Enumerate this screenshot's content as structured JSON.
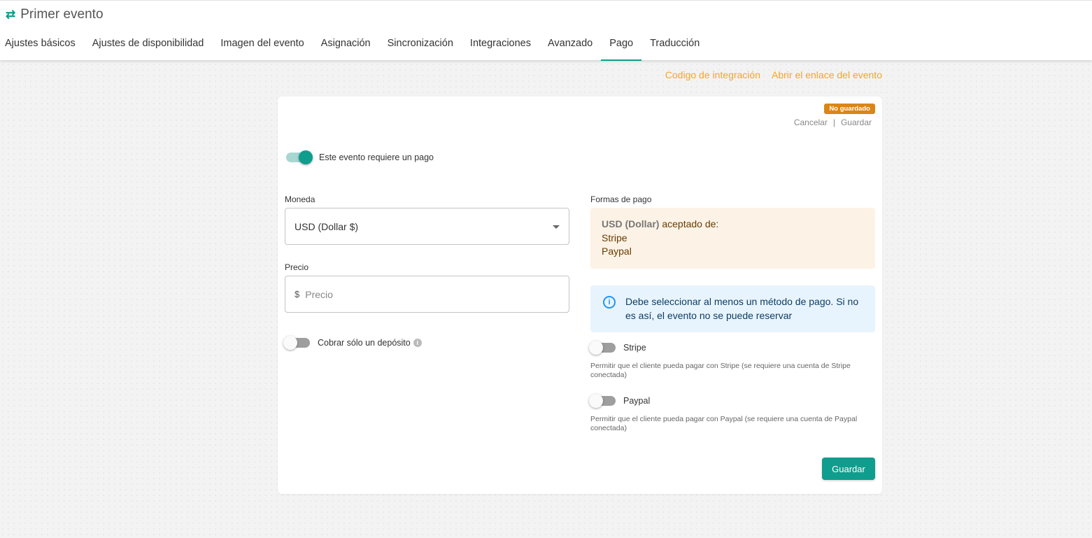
{
  "header": {
    "title_icon": "⇄",
    "title": "Primer evento",
    "tabs": [
      {
        "label": "Ajustes básicos"
      },
      {
        "label": "Ajustes de disponibilidad"
      },
      {
        "label": "Imagen del evento"
      },
      {
        "label": "Asignación"
      },
      {
        "label": "Sincronización"
      },
      {
        "label": "Integraciones"
      },
      {
        "label": "Avanzado"
      },
      {
        "label": "Pago",
        "active": true
      },
      {
        "label": "Traducción"
      }
    ]
  },
  "links": {
    "integration_code": "Codigo de integración",
    "open_event_link": "Abrir el enlace del evento"
  },
  "card": {
    "badge": "No guardado",
    "cancel": "Cancelar",
    "separator": "|",
    "save_link": "Guardar",
    "requires_payment": {
      "label": "Este evento requiere un pago",
      "on": true
    },
    "currency": {
      "label": "Moneda",
      "value": "USD (Dollar $)"
    },
    "price": {
      "label": "Precio",
      "prefix": "$",
      "placeholder": "Precio"
    },
    "deposit": {
      "label": "Cobrar sólo un depósito",
      "on": false,
      "info_icon": "i"
    },
    "payment_methods": {
      "label": "Formas de pago",
      "currency_bold": "USD (Dollar)",
      "accepted_text": " aceptado de:",
      "methods": [
        "Stripe",
        "Paypal"
      ]
    },
    "info": {
      "icon": "i",
      "text": "Debe seleccionar al menos un método de pago. Si no es así, el evento no se puede reservar"
    },
    "stripe": {
      "label": "Stripe",
      "on": false,
      "description": "Permitir que el cliente pueda pagar con Stripe (se requiere una cuenta de Stripe conectada)"
    },
    "paypal": {
      "label": "Paypal",
      "on": false,
      "description": "Permitir que el cliente pueda pagar con Paypal (se requiere una cuenta de Paypal conectada)"
    },
    "save_button": "Guardar"
  },
  "colors": {
    "accent": "#0f9d8d",
    "link": "#f5a623",
    "badge": "#d98616",
    "info_bg": "#e8f4fd",
    "pay_bg": "#fdf2e6"
  }
}
